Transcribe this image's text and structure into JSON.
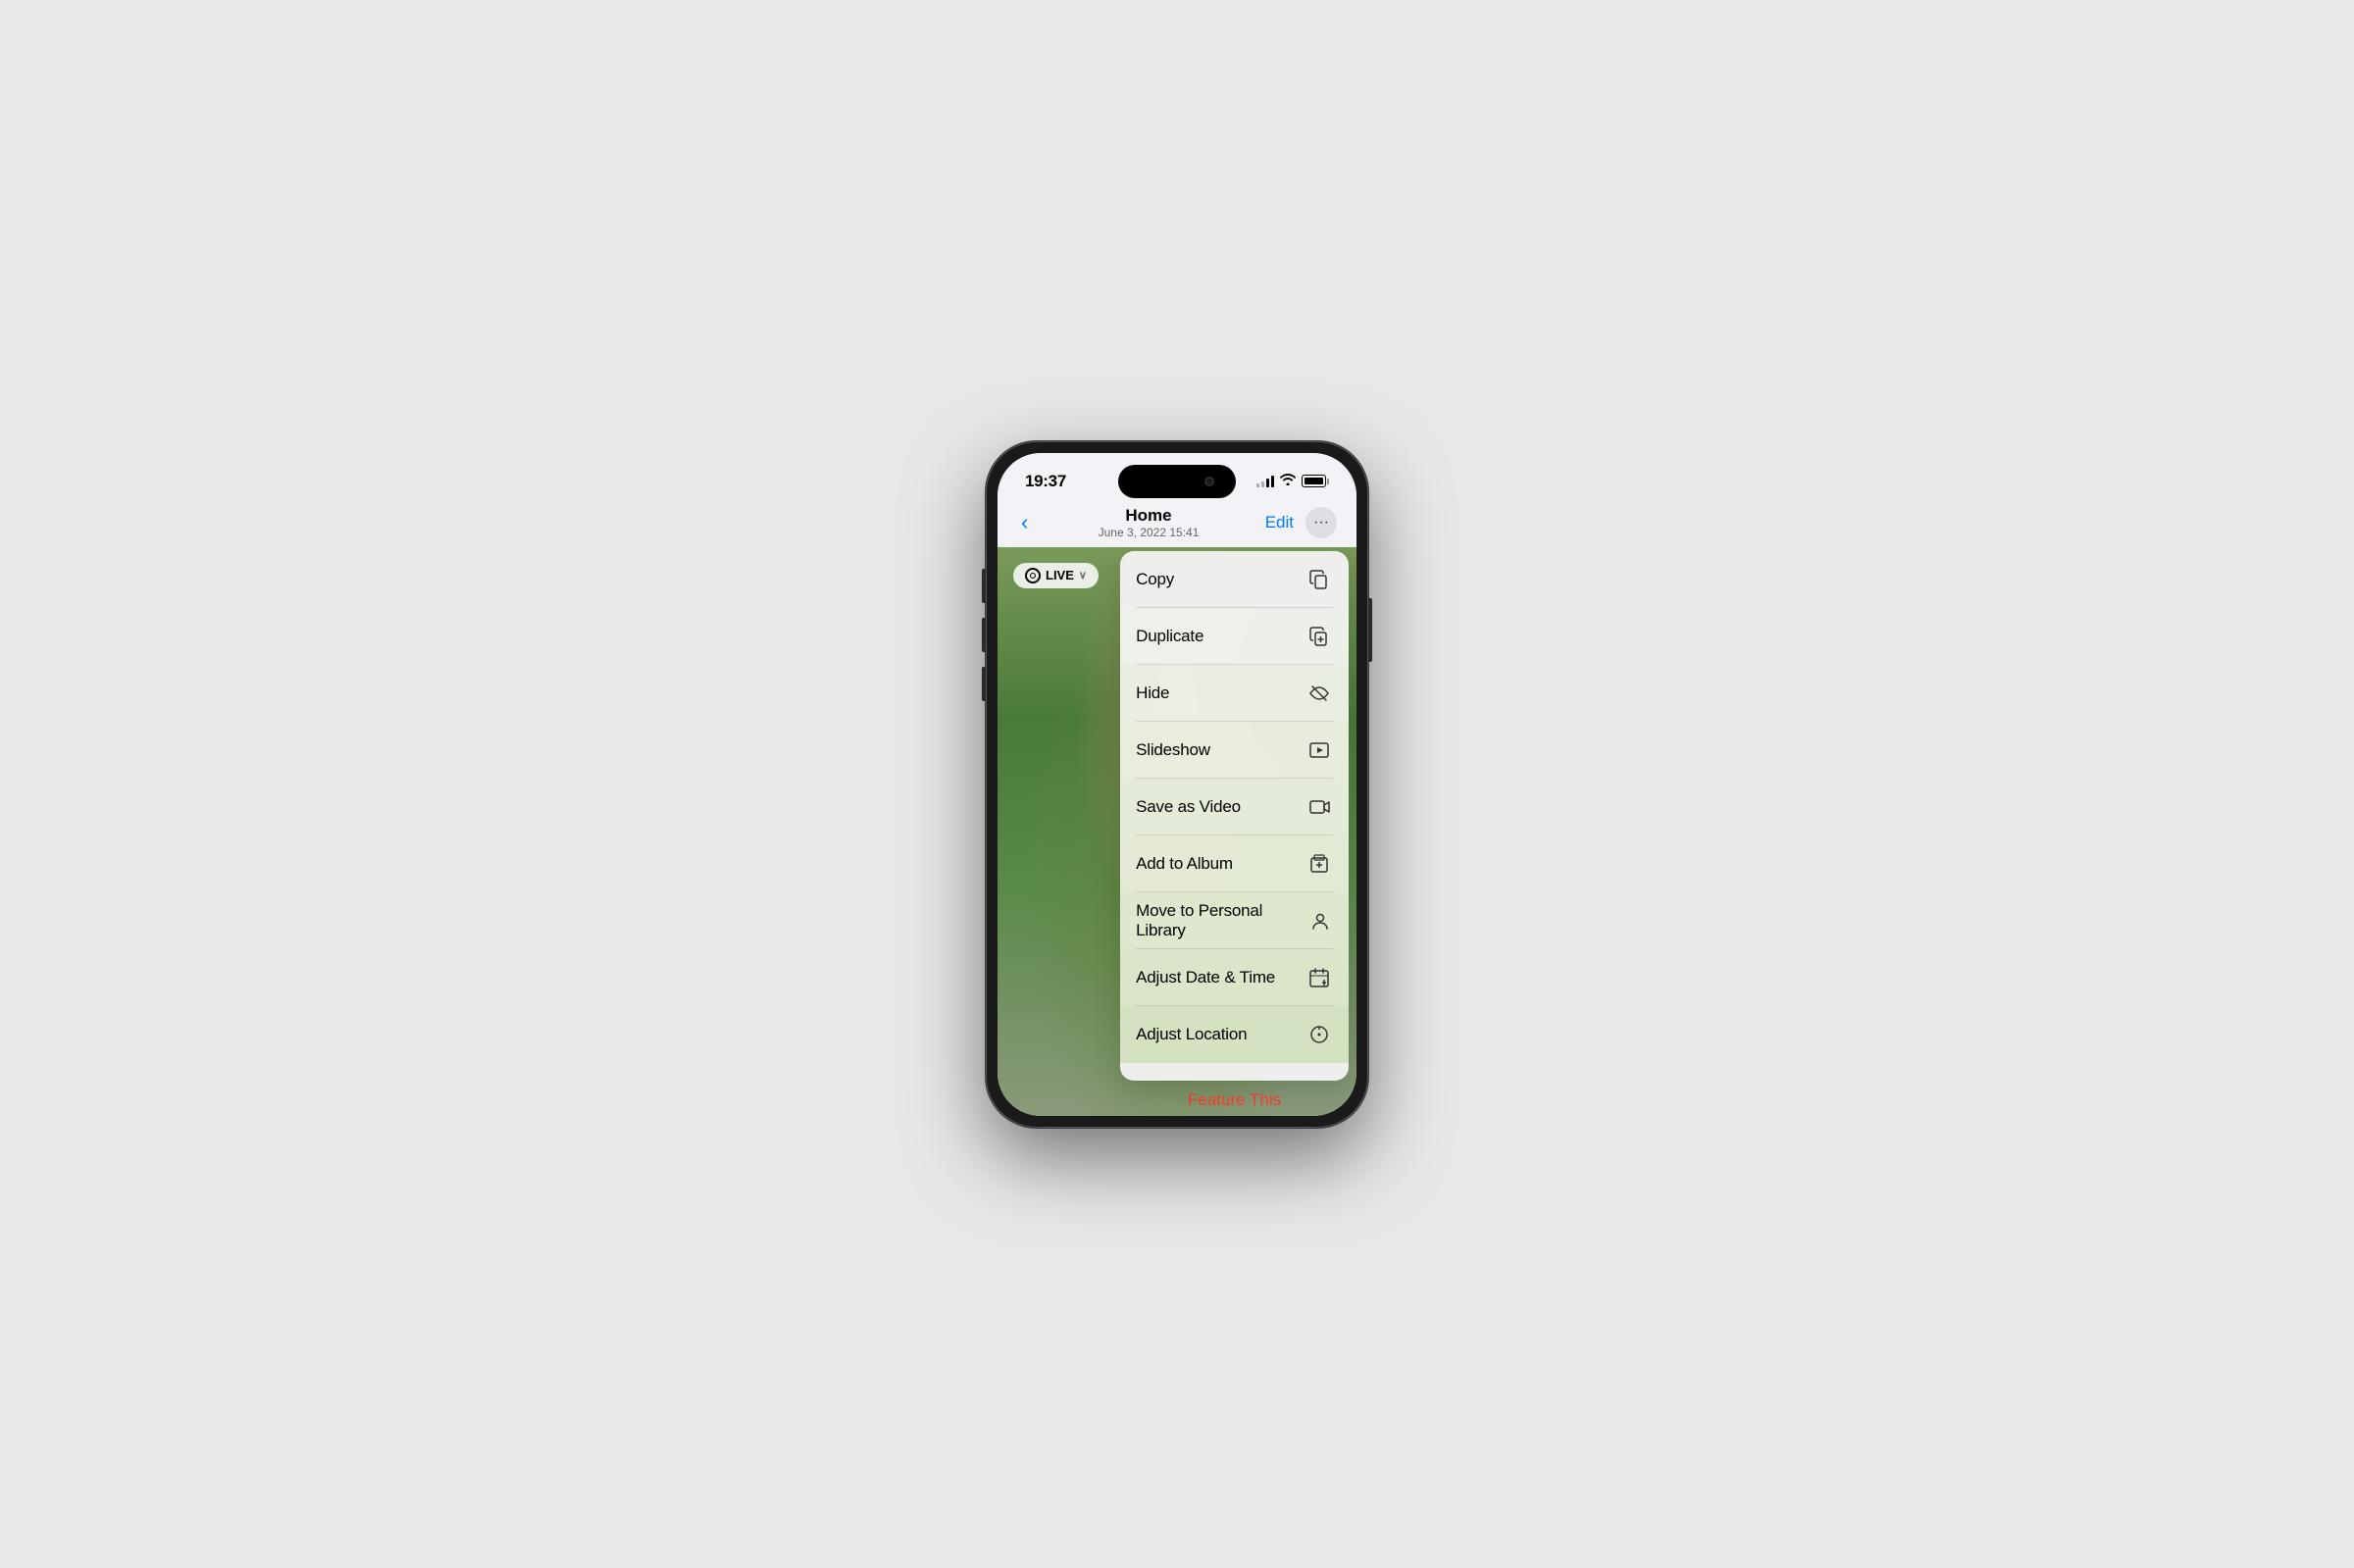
{
  "statusBar": {
    "time": "19:37",
    "signalLabel": "Signal",
    "wifiLabel": "WiFi",
    "batteryLabel": "Battery"
  },
  "navBar": {
    "backLabel": "‹",
    "title": "Home",
    "subtitle": "June 3, 2022  15:41",
    "editLabel": "Edit",
    "moreLabel": "···"
  },
  "liveBadge": {
    "label": "LIVE",
    "chevron": "∨"
  },
  "menu": {
    "items": [
      {
        "label": "Copy",
        "icon": "⎘"
      },
      {
        "label": "Duplicate",
        "icon": "⊞"
      },
      {
        "label": "Hide",
        "icon": "◎"
      },
      {
        "label": "Slideshow",
        "icon": "▶"
      },
      {
        "label": "Save as Video",
        "icon": "⬛"
      },
      {
        "label": "Add to Album",
        "icon": "⊕"
      },
      {
        "label": "Move to Personal Library",
        "icon": "👤"
      },
      {
        "label": "Adjust Date & Time",
        "icon": "📅"
      },
      {
        "label": "Adjust Location",
        "icon": "ℹ"
      }
    ],
    "featureThis": "Feature This"
  }
}
